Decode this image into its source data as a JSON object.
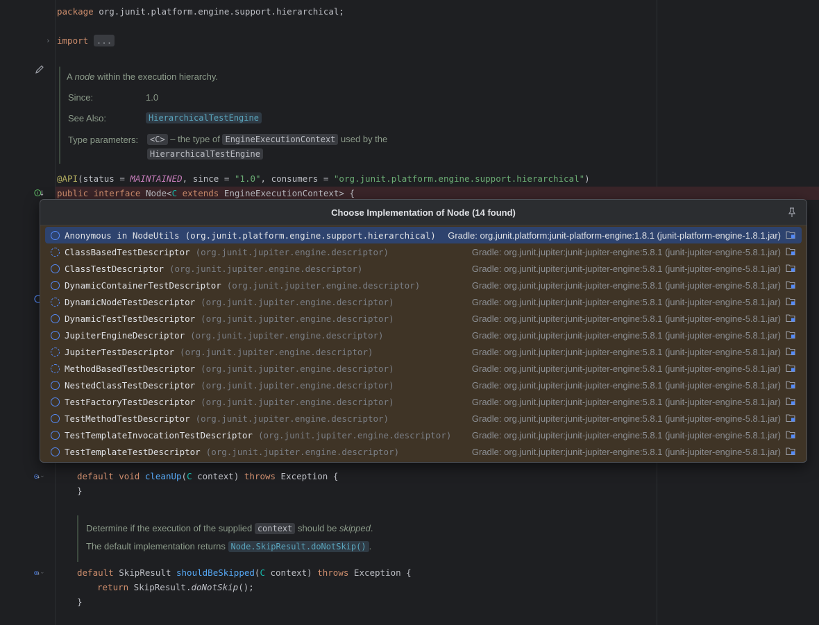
{
  "editor": {
    "package_kw": "package",
    "package_name": " org.junit.platform.engine.support.hierarchical;",
    "import_kw": "import",
    "import_folded": "...",
    "doc1": {
      "text_pre": "A ",
      "text_em": "node",
      "text_post": " within the execution hierarchy.",
      "since_label": "Since:",
      "since_value": "1.0",
      "see_also_label": "See Also:",
      "see_also_link": "HierarchicalTestEngine",
      "type_params_label": "Type parameters:",
      "type_param": "<C>",
      "type_param_desc_pre": " – the type of ",
      "type_param_code": "EngineExecutionContext",
      "type_param_desc_post": " used by the",
      "type_param_code2": "HierarchicalTestEngine"
    },
    "annotation": {
      "name": "@API",
      "p1": "(status = ",
      "status": "MAINTAINED",
      "p2": ", since = ",
      "since": "\"1.0\"",
      "p3": ", consumers = ",
      "consumers": "\"org.junit.platform.engine.support.hierarchical\"",
      "p4": ")"
    },
    "decl": {
      "public": "public",
      "interface": " interface",
      "name": " Node<",
      "tparam": "C",
      "extends": " extends",
      "rest": " EngineExecutionContext> {"
    },
    "cleanup": {
      "default": "default",
      "void": " void",
      "fn": " cleanUp",
      "p1": "(",
      "tp": "C",
      "p2": " context) ",
      "throws": "throws",
      "rest": " Exception {",
      "close": "}"
    },
    "doc2": {
      "l1_pre": "Determine if the execution of the supplied ",
      "l1_code": "context",
      "l1_mid": " should be ",
      "l1_em": "skipped",
      "l1_post": ".",
      "l2_pre": "The default implementation returns ",
      "l2_link": "Node.SkipResult.doNotSkip()",
      "l2_post": "."
    },
    "skip": {
      "default": "default",
      "type": " SkipResult",
      "fn": " shouldBeSkipped",
      "p1": "(",
      "tp": "C",
      "p2": " context) ",
      "throws": "throws",
      "rest": " Exception {",
      "return": "return",
      "ret_type": " SkipResult.",
      "ret_fn": "doNotSkip",
      "ret_end": "();",
      "close": "}"
    }
  },
  "popup": {
    "title": "Choose Implementation of Node (14 found)",
    "rows": [
      {
        "name": "Anonymous in NodeUtils",
        "pkg": "(org.junit.platform.engine.support.hierarchical)",
        "lib": "Gradle: org.junit.platform:junit-platform-engine:1.8.1 (junit-platform-engine-1.8.1.jar)",
        "selected": true,
        "abstract": false
      },
      {
        "name": "ClassBasedTestDescriptor",
        "pkg": "(org.junit.jupiter.engine.descriptor)",
        "lib": "Gradle: org.junit.jupiter:junit-jupiter-engine:5.8.1 (junit-jupiter-engine-5.8.1.jar)",
        "selected": false,
        "abstract": true
      },
      {
        "name": "ClassTestDescriptor",
        "pkg": "(org.junit.jupiter.engine.descriptor)",
        "lib": "Gradle: org.junit.jupiter:junit-jupiter-engine:5.8.1 (junit-jupiter-engine-5.8.1.jar)",
        "selected": false,
        "abstract": false
      },
      {
        "name": "DynamicContainerTestDescriptor",
        "pkg": "(org.junit.jupiter.engine.descriptor)",
        "lib": "Gradle: org.junit.jupiter:junit-jupiter-engine:5.8.1 (junit-jupiter-engine-5.8.1.jar)",
        "selected": false,
        "abstract": false
      },
      {
        "name": "DynamicNodeTestDescriptor",
        "pkg": "(org.junit.jupiter.engine.descriptor)",
        "lib": "Gradle: org.junit.jupiter:junit-jupiter-engine:5.8.1 (junit-jupiter-engine-5.8.1.jar)",
        "selected": false,
        "abstract": true
      },
      {
        "name": "DynamicTestTestDescriptor",
        "pkg": "(org.junit.jupiter.engine.descriptor)",
        "lib": "Gradle: org.junit.jupiter:junit-jupiter-engine:5.8.1 (junit-jupiter-engine-5.8.1.jar)",
        "selected": false,
        "abstract": false
      },
      {
        "name": "JupiterEngineDescriptor",
        "pkg": "(org.junit.jupiter.engine.descriptor)",
        "lib": "Gradle: org.junit.jupiter:junit-jupiter-engine:5.8.1 (junit-jupiter-engine-5.8.1.jar)",
        "selected": false,
        "abstract": false
      },
      {
        "name": "JupiterTestDescriptor",
        "pkg": "(org.junit.jupiter.engine.descriptor)",
        "lib": "Gradle: org.junit.jupiter:junit-jupiter-engine:5.8.1 (junit-jupiter-engine-5.8.1.jar)",
        "selected": false,
        "abstract": true
      },
      {
        "name": "MethodBasedTestDescriptor",
        "pkg": "(org.junit.jupiter.engine.descriptor)",
        "lib": "Gradle: org.junit.jupiter:junit-jupiter-engine:5.8.1 (junit-jupiter-engine-5.8.1.jar)",
        "selected": false,
        "abstract": true
      },
      {
        "name": "NestedClassTestDescriptor",
        "pkg": "(org.junit.jupiter.engine.descriptor)",
        "lib": "Gradle: org.junit.jupiter:junit-jupiter-engine:5.8.1 (junit-jupiter-engine-5.8.1.jar)",
        "selected": false,
        "abstract": false
      },
      {
        "name": "TestFactoryTestDescriptor",
        "pkg": "(org.junit.jupiter.engine.descriptor)",
        "lib": "Gradle: org.junit.jupiter:junit-jupiter-engine:5.8.1 (junit-jupiter-engine-5.8.1.jar)",
        "selected": false,
        "abstract": false
      },
      {
        "name": "TestMethodTestDescriptor",
        "pkg": "(org.junit.jupiter.engine.descriptor)",
        "lib": "Gradle: org.junit.jupiter:junit-jupiter-engine:5.8.1 (junit-jupiter-engine-5.8.1.jar)",
        "selected": false,
        "abstract": false
      },
      {
        "name": "TestTemplateInvocationTestDescriptor",
        "pkg": "(org.junit.jupiter.engine.descriptor)",
        "lib": "Gradle: org.junit.jupiter:junit-jupiter-engine:5.8.1 (junit-jupiter-engine-5.8.1.jar)",
        "selected": false,
        "abstract": false
      },
      {
        "name": "TestTemplateTestDescriptor",
        "pkg": "(org.junit.jupiter.engine.descriptor)",
        "lib": "Gradle: org.junit.jupiter:junit-jupiter-engine:5.8.1 (junit-jupiter-engine-5.8.1.jar)",
        "selected": false,
        "abstract": false
      }
    ]
  },
  "icons": {
    "fold": "chevron-right-icon",
    "edit": "pencil-icon",
    "impl": "implemented-marker-icon",
    "override": "overriding-method-icon",
    "pin": "pin-icon",
    "class": "class-icon",
    "jar": "library-folder-icon"
  }
}
